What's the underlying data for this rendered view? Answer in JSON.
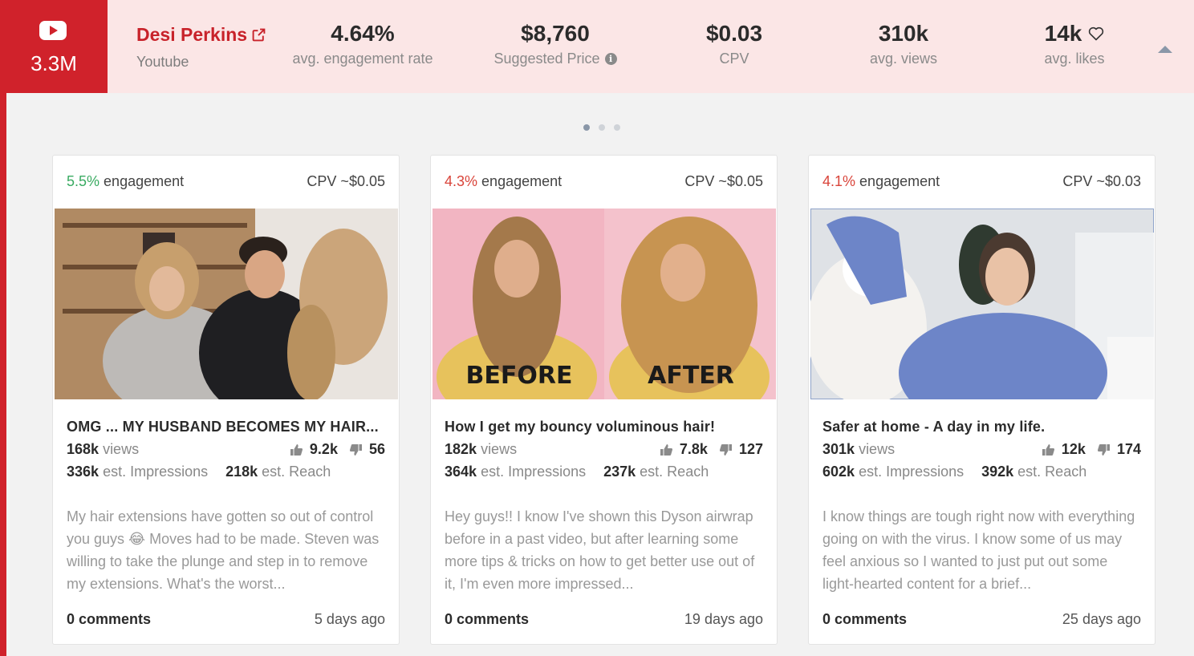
{
  "header": {
    "subscriber_count": "3.3M",
    "platform_icon": "youtube-icon",
    "creator_name": "Desi Perkins",
    "platform": "Youtube",
    "stats": [
      {
        "value": "4.64%",
        "label": "avg. engagement rate"
      },
      {
        "value": "$8,760",
        "label": "Suggested Price"
      },
      {
        "value": "$0.03",
        "label": "CPV"
      },
      {
        "value": "310k",
        "label": "avg. views"
      },
      {
        "value": "14k",
        "label": "avg. likes"
      }
    ]
  },
  "carousel": {
    "page_count": 3,
    "active_index": 0
  },
  "cards": [
    {
      "engagement_value": "5.5%",
      "engagement_label": "engagement",
      "engagement_color": "#3aab62",
      "cpv": "CPV ~$0.05",
      "title": "OMG ... MY HUSBAND BECOMES MY HAIR...",
      "views": "168k",
      "views_label": "views",
      "likes": "9.2k",
      "dislikes": "56",
      "impressions": "336k",
      "impressions_label": "est. Impressions",
      "reach": "218k",
      "reach_label": "est. Reach",
      "description": "My hair extensions have gotten so out of control you guys 😂 Moves had to be made. Steven was willing to take the plunge and step in to remove my extensions. What's the worst...",
      "comments": "0 comments",
      "posted": "5 days ago"
    },
    {
      "engagement_value": "4.3%",
      "engagement_label": "engagement",
      "engagement_color": "#d9443a",
      "cpv": "CPV ~$0.05",
      "title": "How I get my bouncy voluminous hair!",
      "views": "182k",
      "views_label": "views",
      "likes": "7.8k",
      "dislikes": "127",
      "impressions": "364k",
      "impressions_label": "est. Impressions",
      "reach": "237k",
      "reach_label": "est. Reach",
      "thumb_before": "BEFORE",
      "thumb_after": "AFTER",
      "description": "Hey guys!! I know I've shown this Dyson airwrap before in a past video, but after learning some more tips & tricks on how to get better use out of it, I'm even more impressed...",
      "comments": "0 comments",
      "posted": "19 days ago"
    },
    {
      "engagement_value": "4.1%",
      "engagement_label": "engagement",
      "engagement_color": "#d9443a",
      "cpv": "CPV ~$0.03",
      "title": "Safer at home - A day in my life.",
      "views": "301k",
      "views_label": "views",
      "likes": "12k",
      "dislikes": "174",
      "impressions": "602k",
      "impressions_label": "est. Impressions",
      "reach": "392k",
      "reach_label": "est. Reach",
      "description": "I know things are tough right now with everything going on with the virus. I know some of us may feel anxious so I wanted to just put out some light-hearted content for a brief...",
      "comments": "0 comments",
      "posted": "25 days ago"
    }
  ]
}
